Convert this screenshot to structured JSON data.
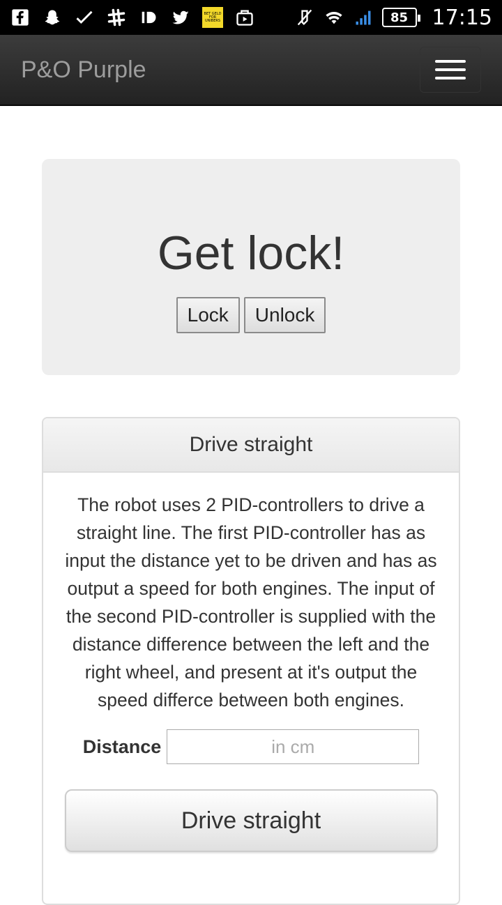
{
  "status_bar": {
    "icons_left": [
      "facebook-icon",
      "snapchat-icon",
      "check-icon",
      "slack-icon",
      "id-icon",
      "twitter-icon",
      "app-badge-icon",
      "video-store-icon"
    ],
    "icons_right": [
      "mute-icon",
      "wifi-icon",
      "signal-icon"
    ],
    "badge_text": "BET GELD FOR UNIBERS",
    "battery": "85",
    "time": "17:15"
  },
  "navbar": {
    "brand": "P&O Purple",
    "menu_icon": "hamburger-icon"
  },
  "jumbotron": {
    "title": "Get lock!",
    "lock_label": "Lock",
    "unlock_label": "Unlock"
  },
  "panel": {
    "heading": "Drive straight",
    "description": "The robot uses 2 PID-controllers to drive a straight line. The first PID-controller has as input the distance yet to be driven and has as output a speed for both engines. The input of the second PID-controller is supplied with the distance difference between the left and the right wheel, and present at it's output the speed differce between both engines.",
    "distance_label": "Distance",
    "distance_placeholder": "in cm",
    "distance_value": "",
    "submit_label": "Drive straight"
  },
  "colors": {
    "navbar_bg": "#222222",
    "brand_text": "#9d9d9d",
    "jumbotron_bg": "#eeeeee",
    "panel_border": "#dddddd"
  }
}
